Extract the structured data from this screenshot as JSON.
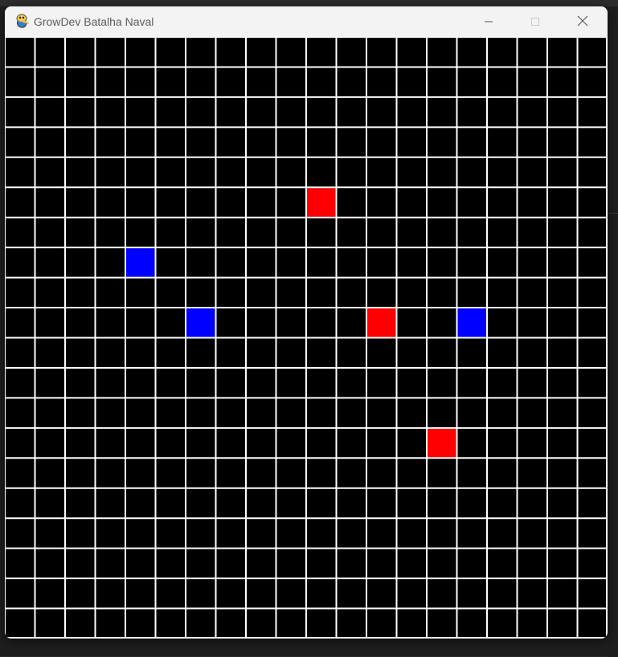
{
  "window": {
    "title": "GrowDev Batalha Naval",
    "icon": "pygame-snake-icon",
    "controls": {
      "minimize": "minimize-icon",
      "maximize": "maximize-icon",
      "close": "close-icon"
    }
  },
  "board": {
    "columns": 20,
    "rows": 20,
    "colors": {
      "background": "#000000",
      "grid_line": "#ffffff",
      "hit": "#ff0000",
      "ship": "#0000ff"
    },
    "marked_cells": [
      {
        "row": 5,
        "col": 10,
        "state": "hit"
      },
      {
        "row": 7,
        "col": 4,
        "state": "ship"
      },
      {
        "row": 9,
        "col": 6,
        "state": "ship"
      },
      {
        "row": 9,
        "col": 12,
        "state": "hit"
      },
      {
        "row": 9,
        "col": 15,
        "state": "ship"
      },
      {
        "row": 13,
        "col": 14,
        "state": "hit"
      }
    ]
  }
}
